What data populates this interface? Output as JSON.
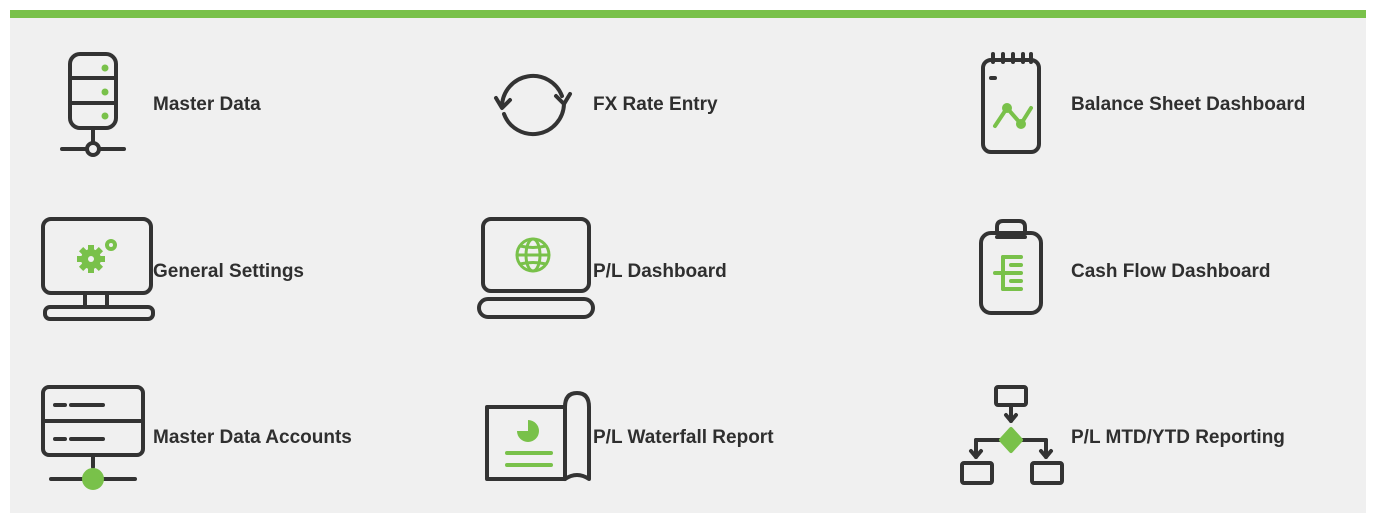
{
  "colors": {
    "accent": "#79c14a",
    "stroke": "#333333",
    "background": "#f0f0f0"
  },
  "tiles": [
    {
      "label": "Master Data",
      "icon": "database-server-icon"
    },
    {
      "label": "FX Rate Entry",
      "icon": "refresh-cycle-icon"
    },
    {
      "label": "Balance Sheet Dashboard",
      "icon": "notepad-chart-icon"
    },
    {
      "label": "General Settings",
      "icon": "monitor-gears-icon"
    },
    {
      "label": "P/L Dashboard",
      "icon": "laptop-globe-icon"
    },
    {
      "label": "Cash Flow Dashboard",
      "icon": "clipboard-list-icon"
    },
    {
      "label": "Master Data Accounts",
      "icon": "server-network-icon"
    },
    {
      "label": "P/L Waterfall Report",
      "icon": "scroll-report-icon"
    },
    {
      "label": "P/L MTD/YTD Reporting",
      "icon": "flowchart-icon"
    }
  ]
}
